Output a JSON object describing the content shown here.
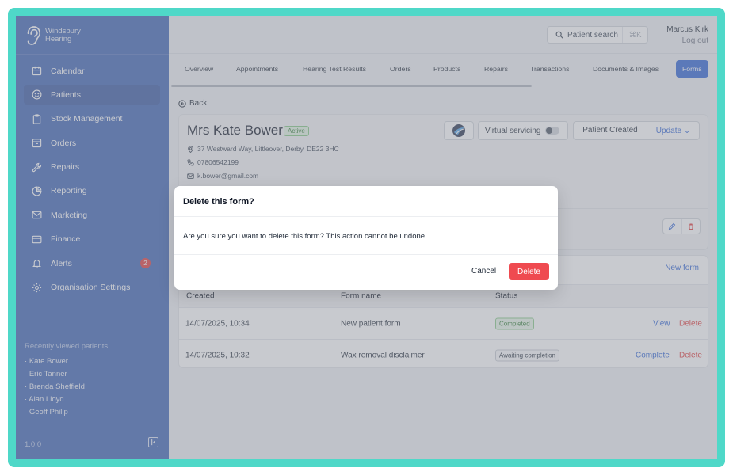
{
  "brand": {
    "line1": "Windsbury",
    "line2": "Hearing"
  },
  "sidebar": {
    "items": [
      {
        "label": "Calendar",
        "icon": "calendar-icon"
      },
      {
        "label": "Patients",
        "icon": "smiley-icon",
        "active": true
      },
      {
        "label": "Stock Management",
        "icon": "clipboard-icon"
      },
      {
        "label": "Orders",
        "icon": "box-icon"
      },
      {
        "label": "Repairs",
        "icon": "wrench-icon"
      },
      {
        "label": "Reporting",
        "icon": "pie-chart-icon"
      },
      {
        "label": "Marketing",
        "icon": "mail-icon"
      },
      {
        "label": "Finance",
        "icon": "card-icon"
      },
      {
        "label": "Alerts",
        "icon": "bell-icon",
        "badge": "2"
      },
      {
        "label": "Organisation Settings",
        "icon": "gear-icon"
      }
    ],
    "recent_title": "Recently viewed patients",
    "recent": [
      "Kate Bower",
      "Eric Tanner",
      "Brenda Sheffield",
      "Alan Lloyd",
      "Geoff Philip"
    ],
    "version": "1.0.0"
  },
  "header": {
    "search_label": "Patient search",
    "search_shortcut": "⌘K",
    "user_name": "Marcus Kirk",
    "logout": "Log out"
  },
  "tabs": [
    "Overview",
    "Appointments",
    "Hearing Test Results",
    "Orders",
    "Products",
    "Repairs",
    "Transactions",
    "Documents & Images",
    "Forms"
  ],
  "active_tab": "Forms",
  "back_label": "Back",
  "patient": {
    "name": "Mrs Kate Bower",
    "status": "Active",
    "address": "37 Westward Way, Littleover, Derby, DE22 3HC",
    "phone": "07806542199",
    "email": "k.bower@gmail.com",
    "virtual_servicing": "Virtual servicing",
    "created_status": "Patient Created",
    "update_label": "Update"
  },
  "forms": {
    "new_form": "New form",
    "columns": [
      "Created",
      "Form name",
      "Status"
    ],
    "rows": [
      {
        "created": "14/07/2025, 10:34",
        "name": "New patient form",
        "status": "Completed",
        "actions": [
          "View",
          "Delete"
        ]
      },
      {
        "created": "14/07/2025, 10:32",
        "name": "Wax removal disclaimer",
        "status": "Awaiting completion",
        "actions": [
          "Complete",
          "Delete"
        ]
      }
    ]
  },
  "modal": {
    "title": "Delete this form?",
    "body": "Are you sure you want to delete this form? This action cannot be undone.",
    "cancel": "Cancel",
    "delete": "Delete"
  },
  "colors": {
    "sidebar": "#3f64b5",
    "accent": "#2f64d5",
    "danger": "#ef4a50",
    "frame": "#4fd8c8"
  }
}
